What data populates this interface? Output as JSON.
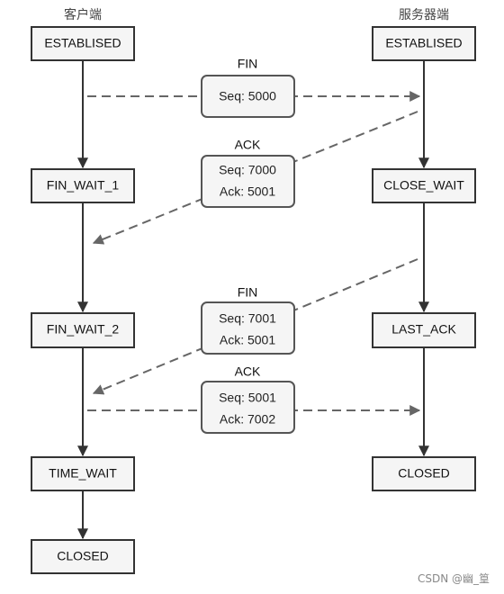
{
  "client": {
    "title": "客户端",
    "states": [
      "ESTABLISED",
      "FIN_WAIT_1",
      "FIN_WAIT_2",
      "TIME_WAIT",
      "CLOSED"
    ]
  },
  "server": {
    "title": "服务器端",
    "states": [
      "ESTABLISED",
      "CLOSE_WAIT",
      "LAST_ACK",
      "CLOSED"
    ]
  },
  "messages": [
    {
      "type": "FIN",
      "lines": [
        "Seq: 5000"
      ],
      "direction": "client-to-server"
    },
    {
      "type": "ACK",
      "lines": [
        "Seq: 7000",
        "Ack: 5001"
      ],
      "direction": "server-to-client"
    },
    {
      "type": "FIN",
      "lines": [
        "Seq: 7001",
        "Ack: 5001"
      ],
      "direction": "server-to-client"
    },
    {
      "type": "ACK",
      "lines": [
        "Seq: 5001",
        "Ack: 7002"
      ],
      "direction": "client-to-server"
    }
  ],
  "watermark": "CSDN @幽_篁"
}
